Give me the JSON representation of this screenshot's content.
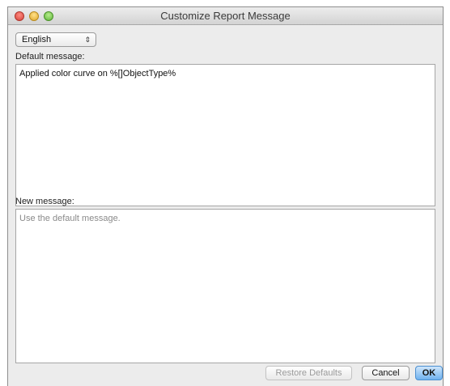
{
  "window": {
    "title": "Customize Report Message"
  },
  "language_select": {
    "value": "English",
    "arrows_glyph": "⇕"
  },
  "default_message": {
    "label": "Default message:",
    "text": "Applied color curve on %[]ObjectType%"
  },
  "new_message": {
    "label": "New message:",
    "placeholder": "Use the default message."
  },
  "buttons": {
    "restore_defaults": "Restore Defaults",
    "cancel": "Cancel",
    "ok": "OK"
  }
}
